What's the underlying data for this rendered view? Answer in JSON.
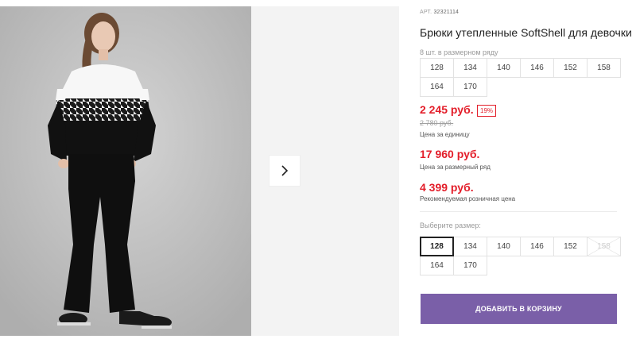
{
  "product": {
    "sku_label": "АРТ.",
    "sku": "32321114",
    "title": "Брюки утепленные SoftShell для девочки"
  },
  "pack": {
    "label": "8 шт. в размерном ряду",
    "sizes": [
      "128",
      "134",
      "140",
      "146",
      "152",
      "158",
      "164",
      "170"
    ]
  },
  "prices": {
    "unit_price": "2 245 руб.",
    "discount": "19%",
    "old_price": "2 780 руб.",
    "unit_caption": "Цена за единицу",
    "pack_price": "17 960 руб.",
    "pack_caption": "Цена за размерный ряд",
    "rrp_price": "4 399 руб.",
    "rrp_caption": "Рекомендуемая розничная цена"
  },
  "size_selector": {
    "label": "Выберите размер:",
    "sizes": [
      "128",
      "134",
      "140",
      "146",
      "152",
      "158",
      "164",
      "170"
    ],
    "selected": "128",
    "unavailable": [
      "158"
    ]
  },
  "actions": {
    "add_to_cart": "ДОБАВИТЬ В КОРЗИНУ"
  },
  "colors": {
    "price_red": "#e31e2a",
    "button_purple": "#7a5fa8"
  },
  "icons": {
    "next": "chevron-right-icon"
  }
}
